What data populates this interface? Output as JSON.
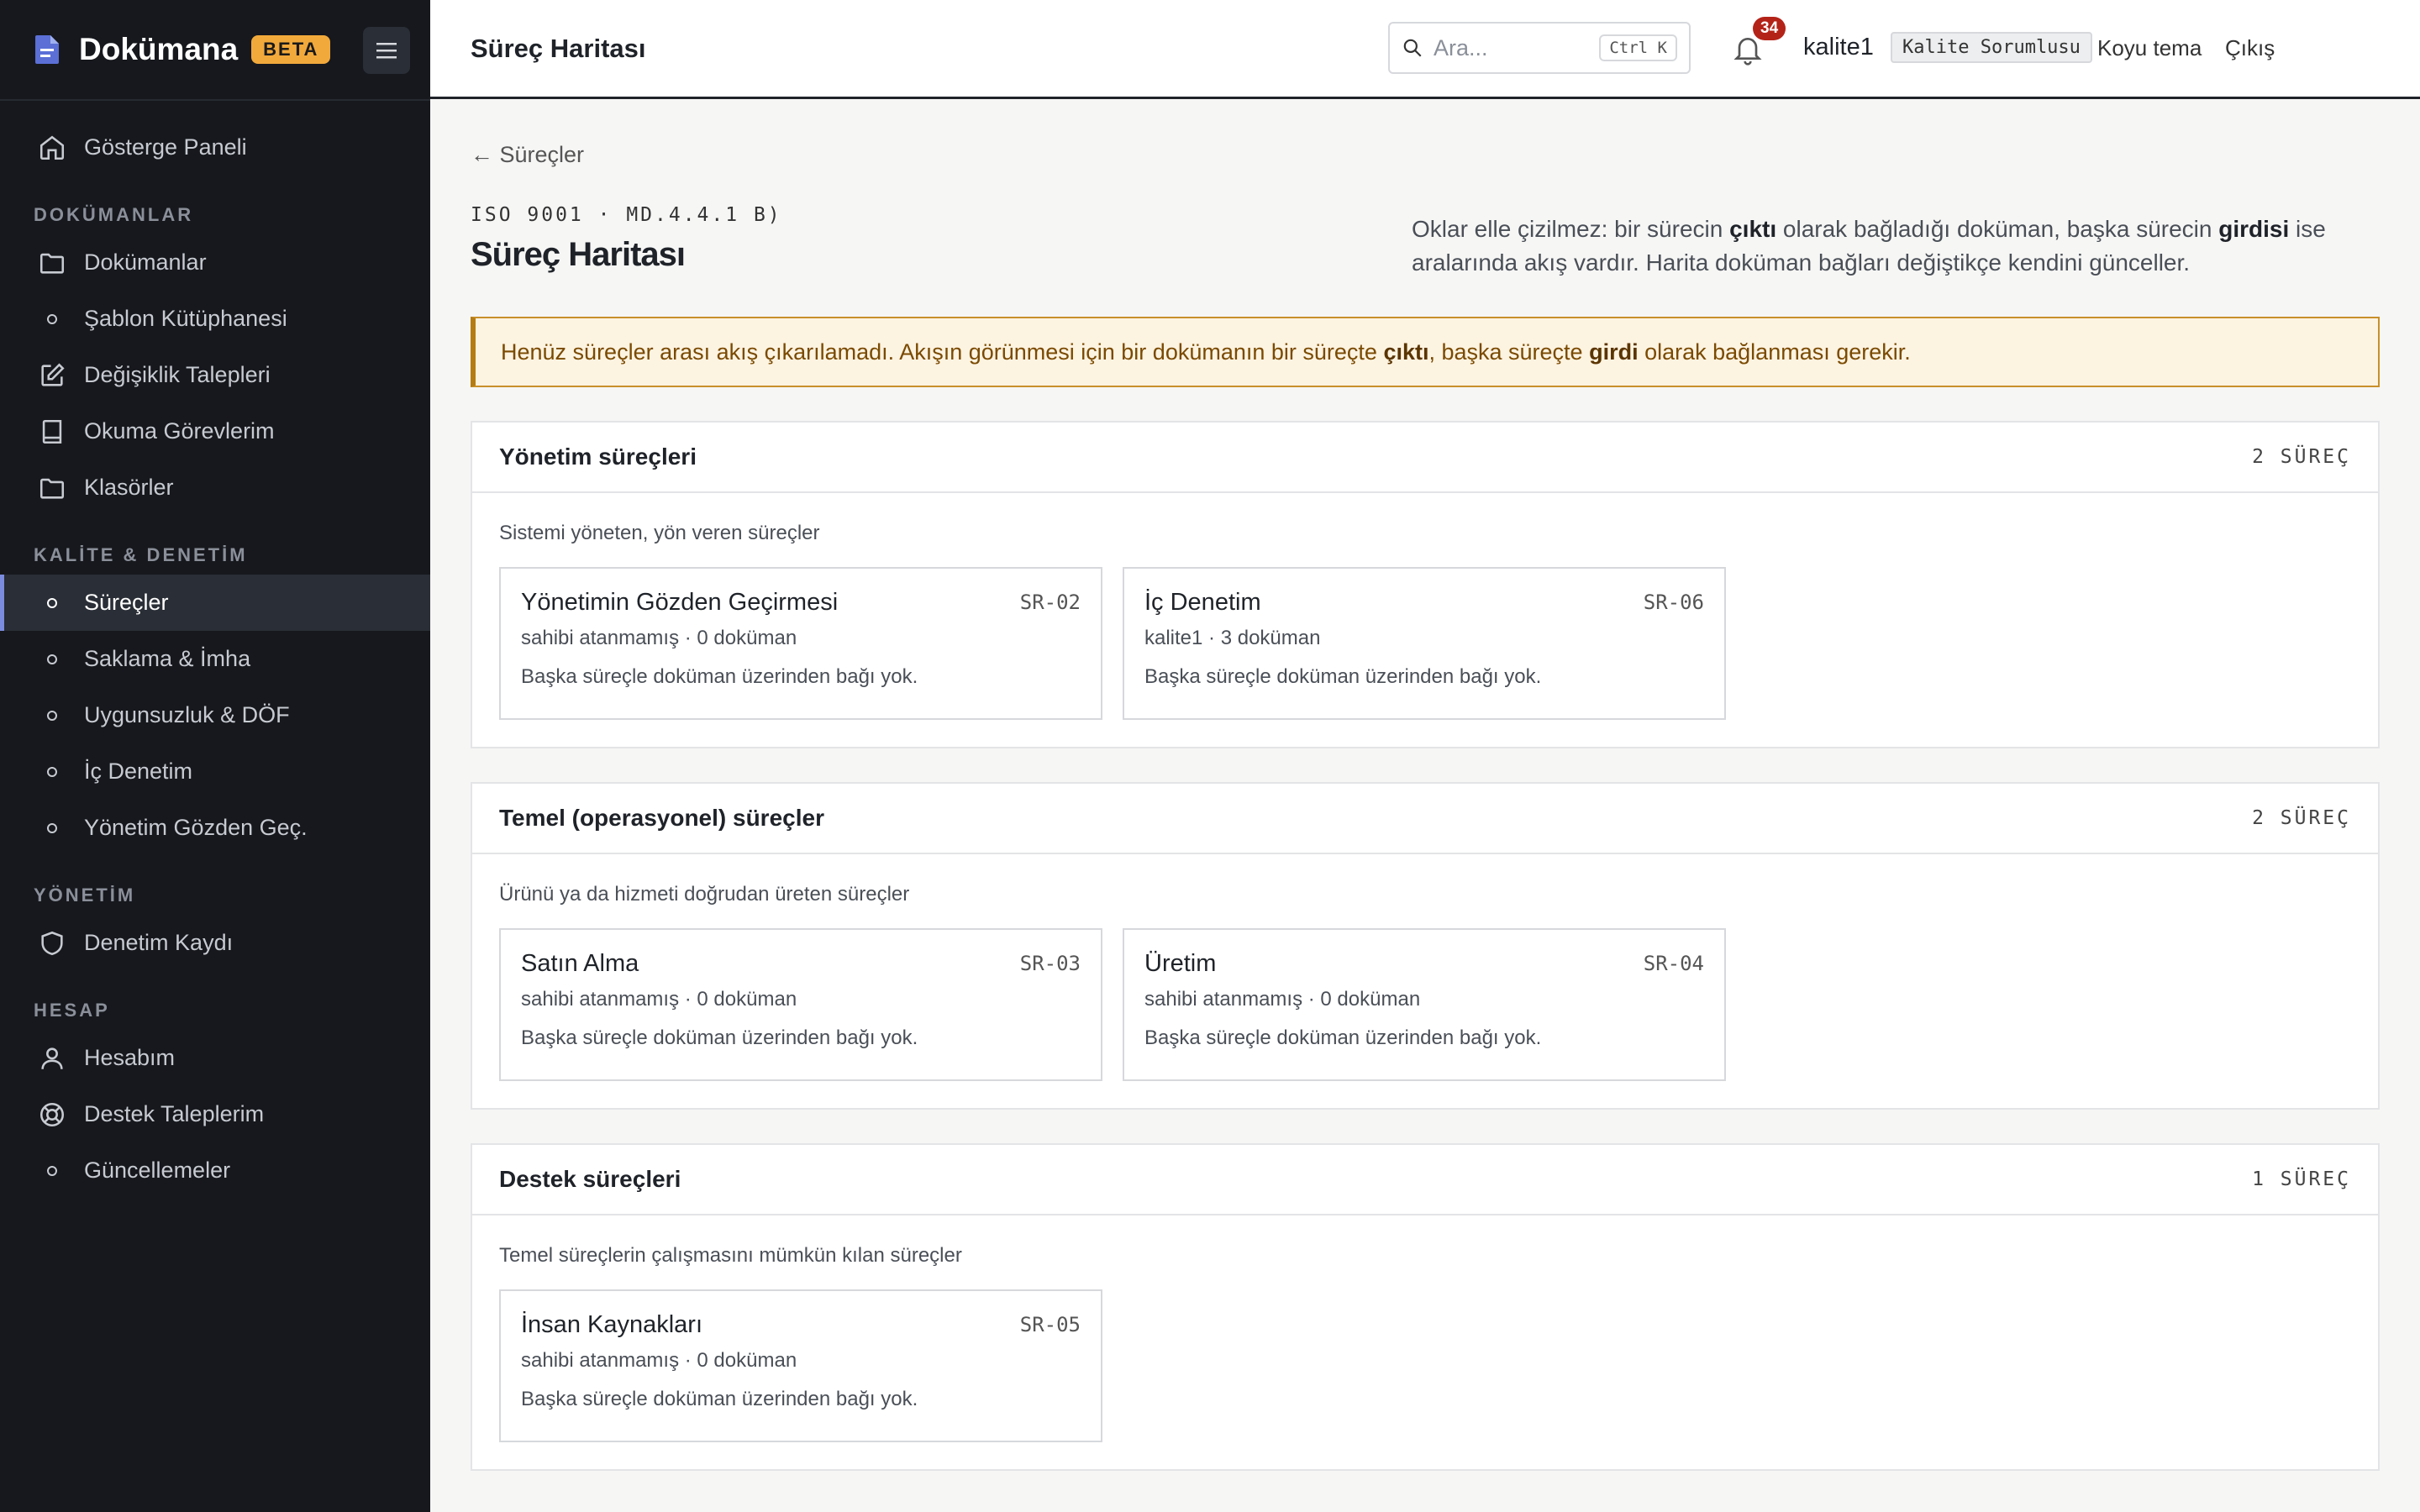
{
  "brand": {
    "name": "Dokümana",
    "badge": "BETA"
  },
  "sidebar": {
    "top_item": "Gösterge Paneli",
    "sections": [
      {
        "title": "DOKÜMANLAR",
        "items": [
          "Dokümanlar",
          "Şablon Kütüphanesi",
          "Değişiklik Talepleri",
          "Okuma Görevlerim",
          "Klasörler"
        ]
      },
      {
        "title": "KALİTE & DENETİM",
        "items": [
          "Süreçler",
          "Saklama & İmha",
          "Uygunsuzluk & DÖF",
          "İç Denetim",
          "Yönetim Gözden Geç."
        ]
      },
      {
        "title": "YÖNETİM",
        "items": [
          "Denetim Kaydı"
        ]
      },
      {
        "title": "HESAP",
        "items": [
          "Hesabım",
          "Destek Taleplerim",
          "Güncellemeler"
        ]
      }
    ],
    "active": "Süreçler"
  },
  "topbar": {
    "title": "Süreç Haritası",
    "search_placeholder": "Ara...",
    "search_shortcut": "Ctrl K",
    "notification_count": "34",
    "username": "kalite1",
    "role": "Kalite Sorumlusu",
    "theme_toggle": "Koyu tema",
    "logout": "Çıkış"
  },
  "page": {
    "back_link": "← Süreçler",
    "eyebrow": "ISO 9001 · MD.4.4.1 B)",
    "title": "Süreç Haritası",
    "intro_parts": [
      "Oklar elle çizilmez: bir sürecin ",
      "çıktı",
      " olarak bağladığı doküman, başka sürecin ",
      "girdisi",
      " ise aralarında akış vardır. Harita doküman bağları değiştikçe kendini günceller."
    ],
    "alert_parts": [
      "Henüz süreçler arası akış çıkarılamadı. Akışın görünmesi için bir dokümanın bir süreçte ",
      "çıktı",
      ", başka süreçte ",
      "girdi",
      " olarak bağlanması gerekir."
    ]
  },
  "groups": [
    {
      "title": "Yönetim süreçleri",
      "count": "2 SÜREÇ",
      "description": "Sistemi yöneten, yön veren süreçler",
      "processes": [
        {
          "name": "Yönetimin Gözden Geçirmesi",
          "code": "SR-02",
          "meta": "sahibi atanmamış · 0 doküman",
          "note": "Başka süreçle doküman üzerinden bağı yok."
        },
        {
          "name": "İç Denetim",
          "code": "SR-06",
          "meta": "kalite1 · 3 doküman",
          "note": "Başka süreçle doküman üzerinden bağı yok."
        }
      ]
    },
    {
      "title": "Temel (operasyonel) süreçler",
      "count": "2 SÜREÇ",
      "description": "Ürünü ya da hizmeti doğrudan üreten süreçler",
      "processes": [
        {
          "name": "Satın Alma",
          "code": "SR-03",
          "meta": "sahibi atanmamış · 0 doküman",
          "note": "Başka süreçle doküman üzerinden bağı yok."
        },
        {
          "name": "Üretim",
          "code": "SR-04",
          "meta": "sahibi atanmamış · 0 doküman",
          "note": "Başka süreçle doküman üzerinden bağı yok."
        }
      ]
    },
    {
      "title": "Destek süreçleri",
      "count": "1 SÜREÇ",
      "description": "Temel süreçlerin çalışmasını mümkün kılan süreçler",
      "processes": [
        {
          "name": "İnsan Kaynakları",
          "code": "SR-05",
          "meta": "sahibi atanmamış · 0 doküman",
          "note": "Başka süreçle doküman üzerinden bağı yok."
        }
      ]
    }
  ],
  "colors": {
    "sidebar_bg": "#16181d",
    "accent": "#7b8cde",
    "beta": "#f2a93b",
    "alert_bg": "#fdf3e1",
    "badge": "#b42318"
  }
}
